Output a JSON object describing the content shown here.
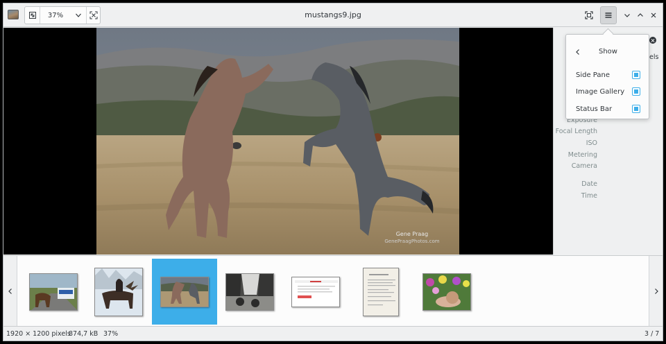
{
  "window": {
    "title": "mustangs9.jpg"
  },
  "toolbar": {
    "zoom_value": "37%",
    "icons": [
      "app-icon",
      "zoom-fit-icon",
      "chevron-down-icon",
      "zoom-original-icon",
      "fullscreen-icon",
      "hamburger-menu-icon",
      "minimize-icon",
      "maximize-icon",
      "close-icon"
    ]
  },
  "photo": {
    "credit_line1": "Gene Praag",
    "credit_line2": "GenePraagPhotos.com"
  },
  "side_pane": {
    "cut_label": "els",
    "properties": [
      "Exposure",
      "Focal Length",
      "ISO",
      "Metering",
      "Camera",
      "Date",
      "Time"
    ]
  },
  "show_menu": {
    "title": "Show",
    "items": [
      {
        "label": "Side Pane",
        "checked": true
      },
      {
        "label": "Image Gallery",
        "checked": true
      },
      {
        "label": "Status Bar",
        "checked": true
      }
    ]
  },
  "gallery": {
    "selected_index": 2,
    "thumbnails": [
      "moose-road-thumbnail",
      "moose-snow-thumbnail",
      "mustangs-thumbnail",
      "waterfall-thumbnail",
      "document-thumbnail",
      "paper-form-thumbnail",
      "snail-flowers-thumbnail"
    ]
  },
  "status_bar": {
    "dimensions": "1920 × 1200 pixels",
    "file_size": "874,7 kB",
    "zoom": "37%",
    "position": "3 / 7"
  },
  "colors": {
    "accent": "#3daee9",
    "window_bg": "#eff0f1",
    "text": "#31363b",
    "muted_text": "#7f8c8d"
  }
}
